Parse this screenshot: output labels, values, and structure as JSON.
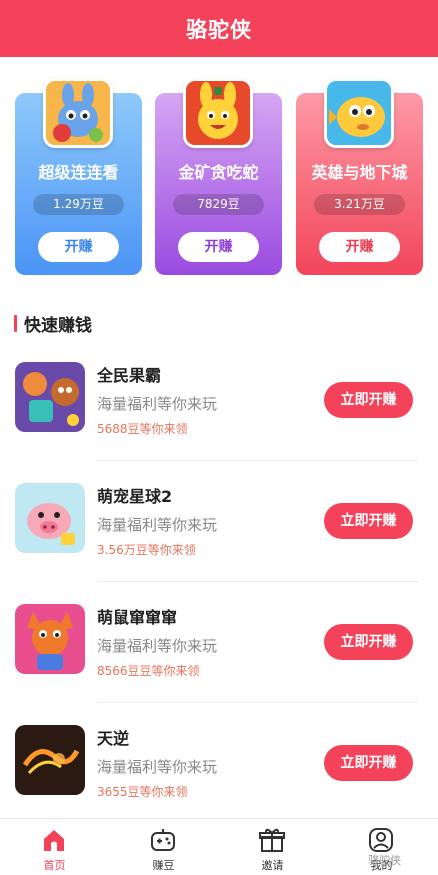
{
  "header": {
    "title": "骆驼侠"
  },
  "featured": [
    {
      "name": "超级连连看",
      "coins": "1.29万豆",
      "button": "开赚",
      "icon": "cartoon-rabbit-fruit-icon"
    },
    {
      "name": "金矿贪吃蛇",
      "coins": "7829豆",
      "button": "开赚",
      "icon": "yellow-bunny-icon"
    },
    {
      "name": "英雄与地下城",
      "coins": "3.21万豆",
      "button": "开赚",
      "icon": "yellow-fish-icon"
    }
  ],
  "section": {
    "title": "快速赚钱"
  },
  "games": [
    {
      "name": "全民果霸",
      "desc": "海量福利等你来玩",
      "reward": "5688豆等你来领",
      "button": "立即开赚"
    },
    {
      "name": "萌宠星球2",
      "desc": "海量福利等你来玩",
      "reward": "3.56万豆等你来领",
      "button": "立即开赚"
    },
    {
      "name": "萌鼠窜窜窜",
      "desc": "海量福利等你来玩",
      "reward": "8566豆豆等你来领",
      "button": "立即开赚"
    },
    {
      "name": "天逆",
      "desc": "海量福利等你来玩",
      "reward": "3655豆等你来领",
      "button": "立即开赚"
    }
  ],
  "tabs": [
    {
      "label": "首页",
      "icon": "home-icon",
      "active": true
    },
    {
      "label": "赚豆",
      "icon": "gamepad-icon",
      "active": false
    },
    {
      "label": "邀请",
      "icon": "gift-icon",
      "active": false
    },
    {
      "label": "我的",
      "icon": "profile-icon",
      "active": false
    }
  ],
  "watermark": "骆驼侠",
  "colors": {
    "accent": "#f4425a",
    "reward": "#e9735b"
  }
}
